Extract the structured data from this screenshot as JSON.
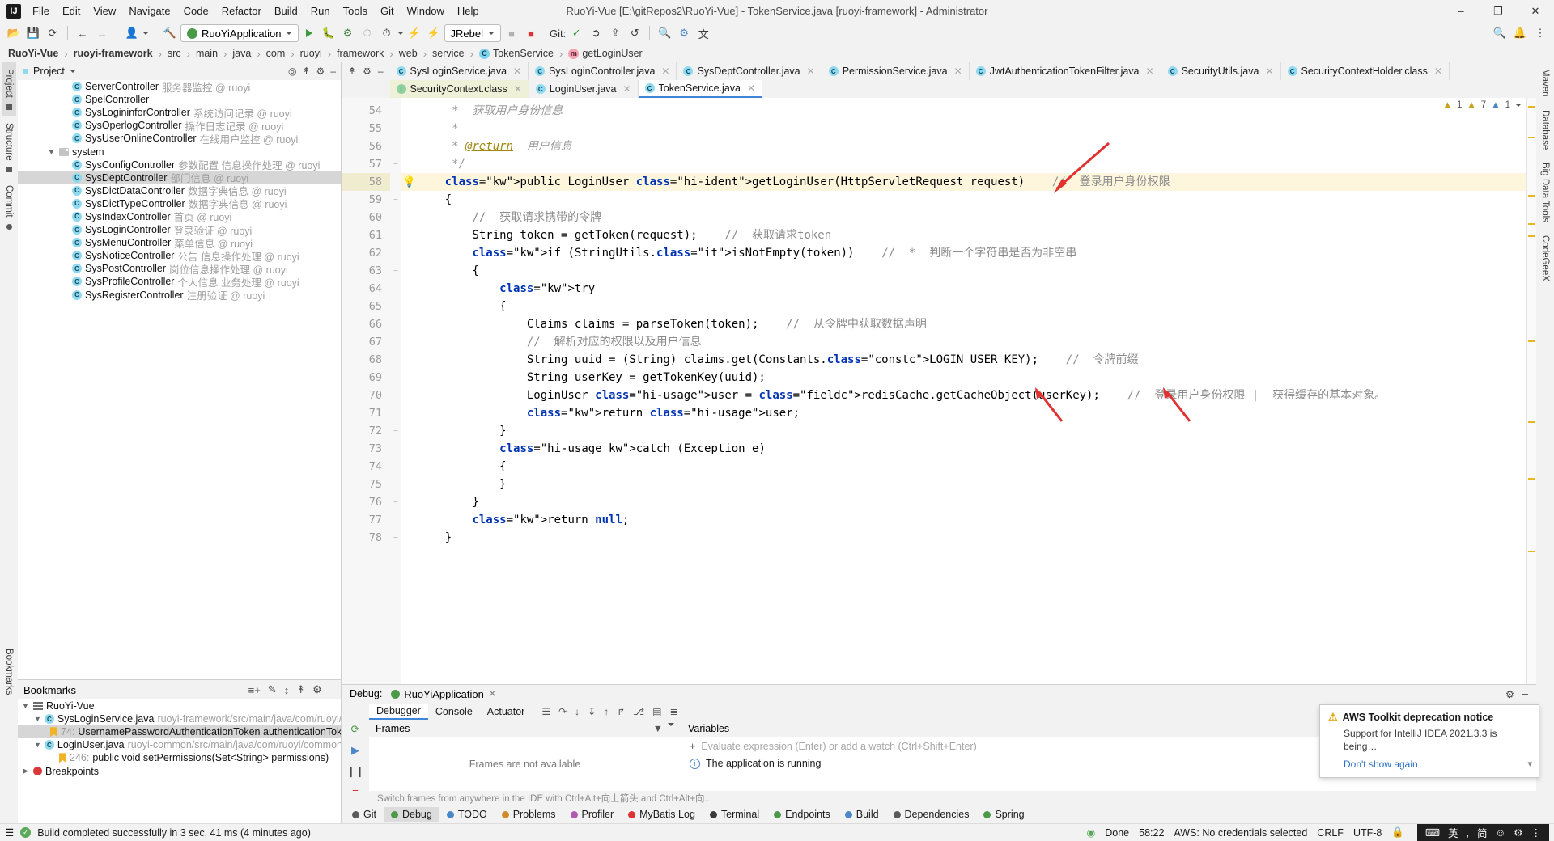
{
  "window": {
    "title": "RuoYi-Vue [E:\\gitRepos2\\RuoYi-Vue] - TokenService.java [ruoyi-framework] - Administrator",
    "minimize": "–",
    "maximize": "❐",
    "close": "✕"
  },
  "menu": [
    "File",
    "Edit",
    "View",
    "Navigate",
    "Code",
    "Refactor",
    "Build",
    "Run",
    "Tools",
    "Git",
    "Window",
    "Help"
  ],
  "toolbar": {
    "run_config": "RuoYiApplication",
    "jrebel": "JRebel",
    "git_label": "Git:",
    "icons": [
      "open-icon",
      "save-icon",
      "sync-icon",
      "back-icon",
      "forward-icon",
      "profile-icon",
      "build-icon"
    ]
  },
  "breadcrumb": [
    {
      "label": "RuoYi-Vue",
      "bold": true,
      "icon": null
    },
    {
      "label": "ruoyi-framework",
      "bold": true,
      "icon": null
    },
    {
      "label": "src",
      "bold": false,
      "icon": null
    },
    {
      "label": "main",
      "bold": false,
      "icon": null
    },
    {
      "label": "java",
      "bold": false,
      "icon": null
    },
    {
      "label": "com",
      "bold": false,
      "icon": null
    },
    {
      "label": "ruoyi",
      "bold": false,
      "icon": null
    },
    {
      "label": "framework",
      "bold": false,
      "icon": null
    },
    {
      "label": "web",
      "bold": false,
      "icon": null
    },
    {
      "label": "service",
      "bold": false,
      "icon": null
    },
    {
      "label": "TokenService",
      "bold": false,
      "icon": "class"
    },
    {
      "label": "getLoginUser",
      "bold": false,
      "icon": "method"
    }
  ],
  "left_rail": [
    "Project",
    "Structure",
    "Commit"
  ],
  "left_rail_bottom": [
    "Bookmarks"
  ],
  "right_rail": [
    "Maven",
    "Database",
    "Big Data Tools",
    "CodeGeeX"
  ],
  "project_panel": {
    "title": "Project",
    "tree": [
      {
        "indent": 3,
        "icon": "class",
        "name": "ServerController",
        "desc": "服务器监控 @ ruoyi"
      },
      {
        "indent": 3,
        "icon": "class",
        "name": "SpelController",
        "desc": ""
      },
      {
        "indent": 3,
        "icon": "class",
        "name": "SysLogininforController",
        "desc": "系统访问记录 @ ruoyi"
      },
      {
        "indent": 3,
        "icon": "class",
        "name": "SysOperlogController",
        "desc": "操作日志记录 @ ruoyi"
      },
      {
        "indent": 3,
        "icon": "class",
        "name": "SysUserOnlineController",
        "desc": "在线用户监控 @ ruoyi"
      },
      {
        "indent": 2,
        "icon": "folder",
        "name": "system",
        "desc": "",
        "expanded": true
      },
      {
        "indent": 3,
        "icon": "class",
        "name": "SysConfigController",
        "desc": "参数配置 信息操作处理 @ ruoyi"
      },
      {
        "indent": 3,
        "icon": "class",
        "name": "SysDeptController",
        "desc": "部门信息 @ ruoyi",
        "selected": true
      },
      {
        "indent": 3,
        "icon": "class",
        "name": "SysDictDataController",
        "desc": "数据字典信息 @ ruoyi"
      },
      {
        "indent": 3,
        "icon": "class",
        "name": "SysDictTypeController",
        "desc": "数据字典信息 @ ruoyi"
      },
      {
        "indent": 3,
        "icon": "class",
        "name": "SysIndexController",
        "desc": "首页 @ ruoyi"
      },
      {
        "indent": 3,
        "icon": "class",
        "name": "SysLoginController",
        "desc": "登录验证 @ ruoyi"
      },
      {
        "indent": 3,
        "icon": "class",
        "name": "SysMenuController",
        "desc": "菜单信息 @ ruoyi"
      },
      {
        "indent": 3,
        "icon": "class",
        "name": "SysNoticeController",
        "desc": "公告 信息操作处理 @ ruoyi"
      },
      {
        "indent": 3,
        "icon": "class",
        "name": "SysPostController",
        "desc": "岗位信息操作处理 @ ruoyi"
      },
      {
        "indent": 3,
        "icon": "class",
        "name": "SysProfileController",
        "desc": "个人信息 业务处理 @ ruoyi"
      },
      {
        "indent": 3,
        "icon": "class",
        "name": "SysRegisterController",
        "desc": "注册验证 @ ruoyi"
      }
    ]
  },
  "bookmarks_panel": {
    "title": "Bookmarks",
    "items": [
      {
        "indent": 0,
        "icon": "list",
        "name": "RuoYi-Vue",
        "desc": "",
        "expanded": true
      },
      {
        "indent": 1,
        "icon": "class",
        "name": "SysLoginService.java",
        "desc": "ruoyi-framework/src/main/java/com/ruoyi/framework",
        "expanded": true
      },
      {
        "indent": 2,
        "icon": "bookmark",
        "num": "74:",
        "name": "UsernamePasswordAuthenticationToken authenticationToken = new",
        "desc": "",
        "selected": true
      },
      {
        "indent": 1,
        "icon": "class",
        "name": "LoginUser.java",
        "desc": "ruoyi-common/src/main/java/com/ruoyi/common/core/do",
        "expanded": true
      },
      {
        "indent": 2,
        "icon": "bookmark",
        "num": "246:",
        "name": "public void setPermissions(Set<String> permissions)",
        "desc": ""
      },
      {
        "indent": 0,
        "icon": "breakpoint",
        "name": "Breakpoints",
        "desc": "",
        "expanded": false
      }
    ]
  },
  "editor": {
    "tabs_row1": [
      {
        "label": "SysLoginService.java",
        "icon": "class",
        "active": false
      },
      {
        "label": "SysLoginController.java",
        "icon": "class",
        "active": false
      },
      {
        "label": "SysDeptController.java",
        "icon": "class",
        "active": false
      },
      {
        "label": "PermissionService.java",
        "icon": "class",
        "active": false
      },
      {
        "label": "JwtAuthenticationTokenFilter.java",
        "icon": "class",
        "active": false
      },
      {
        "label": "SecurityUtils.java",
        "icon": "class",
        "active": false
      },
      {
        "label": "SecurityContextHolder.class",
        "icon": "class-file",
        "active": false
      }
    ],
    "tabs_row2": [
      {
        "label": "SecurityContext.class",
        "icon": "interface",
        "active": false,
        "classfile": true
      },
      {
        "label": "LoginUser.java",
        "icon": "class",
        "active": false
      },
      {
        "label": "TokenService.java",
        "icon": "class",
        "active": true
      }
    ],
    "inspections": {
      "warnings": "1",
      "weak_warnings": "7",
      "infos": "1"
    },
    "lines": [
      {
        "n": 54,
        "text": "     *  获取用户身份信息"
      },
      {
        "n": 55,
        "text": "     *"
      },
      {
        "n": 56,
        "text": "     * @return  用户信息"
      },
      {
        "n": 57,
        "text": "     */"
      },
      {
        "n": 58,
        "text": "    public LoginUser getLoginUser(HttpServletRequest request)    //  登录用户身份权限",
        "highlighted": true,
        "bulb": true
      },
      {
        "n": 59,
        "text": "    {"
      },
      {
        "n": 60,
        "text": "        //  获取请求携带的令牌"
      },
      {
        "n": 61,
        "text": "        String token = getToken(request);    //  获取请求token"
      },
      {
        "n": 62,
        "text": "        if (StringUtils.isNotEmpty(token))    //  *  判断一个字符串是否为非空串"
      },
      {
        "n": 63,
        "text": "        {"
      },
      {
        "n": 64,
        "text": "            try"
      },
      {
        "n": 65,
        "text": "            {"
      },
      {
        "n": 66,
        "text": "                Claims claims = parseToken(token);    //  从令牌中获取数据声明"
      },
      {
        "n": 67,
        "text": "                //  解析对应的权限以及用户信息"
      },
      {
        "n": 68,
        "text": "                String uuid = (String) claims.get(Constants.LOGIN_USER_KEY);    //  令牌前缀"
      },
      {
        "n": 69,
        "text": "                String userKey = getTokenKey(uuid);"
      },
      {
        "n": 70,
        "text": "                LoginUser user = redisCache.getCacheObject(userKey);    //  登录用户身份权限 |  获得缓存的基本对象。"
      },
      {
        "n": 71,
        "text": "                return user;"
      },
      {
        "n": 72,
        "text": "            }"
      },
      {
        "n": 73,
        "text": "            catch (Exception e)"
      },
      {
        "n": 74,
        "text": "            {"
      },
      {
        "n": 75,
        "text": "            }"
      },
      {
        "n": 76,
        "text": "        }"
      },
      {
        "n": 77,
        "text": "        return null;"
      },
      {
        "n": 78,
        "text": "    }"
      }
    ]
  },
  "debug": {
    "label": "Debug:",
    "session": "RuoYiApplication",
    "tabs": [
      {
        "label": "Debugger",
        "selected": true
      },
      {
        "label": "Console",
        "selected": false
      },
      {
        "label": "Actuator",
        "selected": false
      }
    ],
    "frames_title": "Frames",
    "frames_empty": "Frames are not available",
    "variables_title": "Variables",
    "eval_placeholder": "Evaluate expression (Enter) or add a watch (Ctrl+Shift+Enter)",
    "variable_text": "The application is running",
    "switch_hint": "Switch frames from anywhere in the IDE with Ctrl+Alt+向上箭头 and Ctrl+Alt+向..."
  },
  "toast": {
    "title": "AWS Toolkit deprecation notice",
    "body": "Support for IntelliJ IDEA 2021.3.3 is being…",
    "action": "Don't show again"
  },
  "bottom_nav": [
    {
      "label": "Git",
      "icon": "git-icon",
      "selected": false
    },
    {
      "label": "Debug",
      "icon": "debug-icon",
      "selected": true
    },
    {
      "label": "TODO",
      "icon": "todo-icon",
      "selected": false
    },
    {
      "label": "Problems",
      "icon": "problems-icon",
      "selected": false
    },
    {
      "label": "Profiler",
      "icon": "profiler-icon",
      "selected": false
    },
    {
      "label": "MyBatis Log",
      "icon": "mybatis-icon",
      "selected": false
    },
    {
      "label": "Terminal",
      "icon": "terminal-icon",
      "selected": false
    },
    {
      "label": "Endpoints",
      "icon": "endpoints-icon",
      "selected": false
    },
    {
      "label": "Build",
      "icon": "build-icon",
      "selected": false
    },
    {
      "label": "Dependencies",
      "icon": "dependencies-icon",
      "selected": false
    },
    {
      "label": "Spring",
      "icon": "spring-icon",
      "selected": false
    }
  ],
  "statusbar": {
    "message": "Build completed successfully in 3 sec, 41 ms (4 minutes ago)",
    "done": "Done",
    "caret": "58:22",
    "aws": "AWS: No credentials selected",
    "line_sep": "CRLF",
    "encoding": "UTF-8",
    "ime_lang": "英",
    "ime_mode": "简"
  },
  "colors": {
    "accent": "#4285d6",
    "keyword": "#0033b3",
    "comment": "#8c8c8c",
    "selection": "#fdf6dd",
    "arrow_red": "#e03131",
    "green_run": "#4a9a4a"
  }
}
